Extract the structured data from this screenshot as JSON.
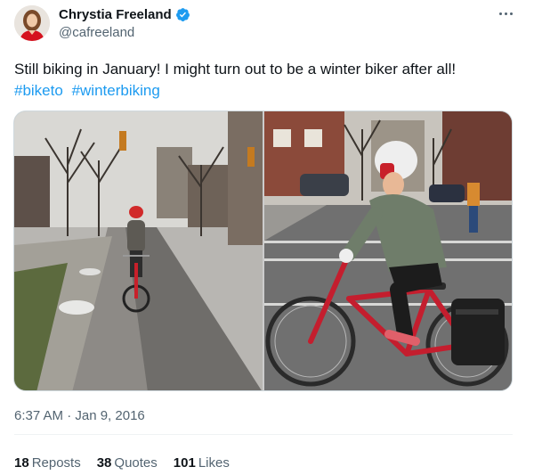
{
  "author": {
    "display_name": "Chrystia Freeland",
    "handle": "@cafreeland",
    "verified_color": "#1d9bf0",
    "avatar_icon": "profile-photo"
  },
  "more_icon": "more-horizontal-icon",
  "tweet": {
    "text": "Still biking in January! I might turn out to be a winter biker after all!",
    "hashtags": [
      "#biketo",
      "#winterbiking"
    ]
  },
  "media": {
    "photos": [
      "photo-woman-cycling-bike-lane-street",
      "photo-woman-on-red-bicycle-closeup"
    ]
  },
  "timestamp": "6:37 AM · Jan 9, 2016",
  "stats": {
    "reposts_count": "18",
    "reposts_label": "Reposts",
    "quotes_count": "38",
    "quotes_label": "Quotes",
    "likes_count": "101",
    "likes_label": "Likes"
  },
  "colors": {
    "link": "#1d9bf0",
    "secondary_text": "#536471",
    "primary_text": "#0f1419"
  }
}
